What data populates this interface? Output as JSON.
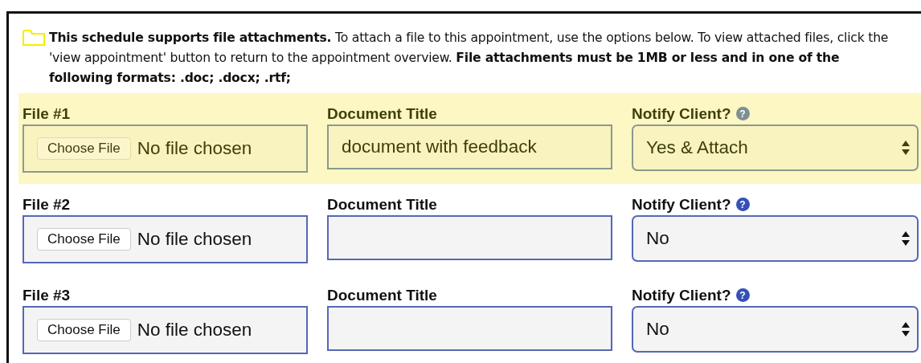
{
  "intro": "**This schedule supports file attachments.** To attach a file to this appointment, use the options below. To view attached files, click the 'view appointment' button to return to the appointment overview. **File attachments must be 1MB or less and in one of the following formats: .doc; .docx; .rtf;**",
  "files": [
    {
      "selected": true,
      "file_label": "File #1",
      "button": "Choose File",
      "file_status": "No file chosen",
      "title_label": "Document Title",
      "title_value": "document with feedback",
      "notify_label": "Notify Client?",
      "help": "?",
      "notify_value": "Yes & Attach"
    },
    {
      "selected": false,
      "file_label": "File #2",
      "button": "Choose File",
      "file_status": "No file chosen",
      "title_label": "Document Title",
      "notify_label": "Notify Client?",
      "help": "?",
      "notify_value": "No"
    },
    {
      "selected": false,
      "file_label": "File #3",
      "button": "Choose File",
      "file_status": "No file chosen",
      "title_label": "Document Title",
      "notify_label": "Notify Client?",
      "help": "?",
      "notify_value": "No"
    }
  ]
}
